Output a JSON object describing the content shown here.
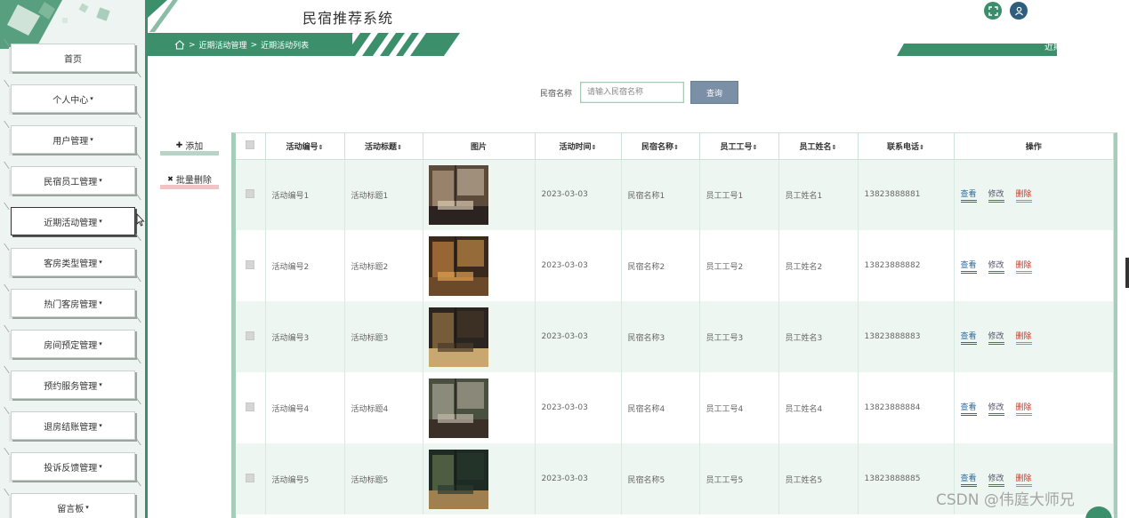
{
  "app": {
    "title": "民宿推荐系统"
  },
  "sidebar": {
    "items": [
      {
        "label": "首页",
        "caret": ""
      },
      {
        "label": "个人中心",
        "caret": "▾"
      },
      {
        "label": "用户管理",
        "caret": "▾"
      },
      {
        "label": "民宿员工管理",
        "caret": "▾"
      },
      {
        "label": "近期活动管理",
        "caret": "▾"
      },
      {
        "label": "客房类型管理",
        "caret": "▾"
      },
      {
        "label": "热门客房管理",
        "caret": "▾"
      },
      {
        "label": "房间预定管理",
        "caret": "▾"
      },
      {
        "label": "预约服务管理",
        "caret": "▾"
      },
      {
        "label": "退房结账管理",
        "caret": "▾"
      },
      {
        "label": "投诉反馈管理",
        "caret": "▾"
      },
      {
        "label": "留言板",
        "caret": "▾"
      }
    ]
  },
  "breadcrumb": {
    "sep1": ">",
    "level1": "近期活动管理",
    "sep2": ">",
    "level2": "近期活动列表"
  },
  "section_title": "近期活动管理",
  "search": {
    "label": "民宿名称",
    "placeholder": "请输入民宿名称",
    "button": "查询"
  },
  "actions": {
    "add": "添加",
    "add_icon": "✚",
    "batch_delete": "批量删除",
    "batch_delete_icon": "✖"
  },
  "table": {
    "headers": {
      "activity_no": "活动编号",
      "activity_title": "活动标题",
      "image": "图片",
      "activity_time": "活动时间",
      "homestay_name": "民宿名称",
      "staff_no": "员工工号",
      "staff_name": "员工姓名",
      "phone": "联系电话",
      "ops": "操作",
      "sort_icon": "⇕"
    },
    "op_labels": {
      "view": "查看",
      "edit": "修改",
      "delete": "删除"
    },
    "rows": [
      {
        "activity_no": "活动编号1",
        "activity_title": "活动标题1",
        "activity_time": "2023-03-03",
        "homestay_name": "民宿名称1",
        "staff_no": "员工工号1",
        "staff_name": "员工姓名1",
        "phone": "13823888881"
      },
      {
        "activity_no": "活动编号2",
        "activity_title": "活动标题2",
        "activity_time": "2023-03-03",
        "homestay_name": "民宿名称2",
        "staff_no": "员工工号2",
        "staff_name": "员工姓名2",
        "phone": "13823888882"
      },
      {
        "activity_no": "活动编号3",
        "activity_title": "活动标题3",
        "activity_time": "2023-03-03",
        "homestay_name": "民宿名称3",
        "staff_no": "员工工号3",
        "staff_name": "员工姓名3",
        "phone": "13823888883"
      },
      {
        "activity_no": "活动编号4",
        "activity_title": "活动标题4",
        "activity_time": "2023-03-03",
        "homestay_name": "民宿名称4",
        "staff_no": "员工工号4",
        "staff_name": "员工姓名4",
        "phone": "13823888884"
      },
      {
        "activity_no": "活动编号5",
        "activity_title": "活动标题5",
        "activity_time": "2023-03-03",
        "homestay_name": "民宿名称5",
        "staff_no": "员工工号5",
        "staff_name": "员工姓名5",
        "phone": "13823888885"
      }
    ]
  },
  "watermark": "CSDN @伟庭大师兄",
  "colors": {
    "primary_green": "#3c8f6b",
    "row_alt": "#eef6f1",
    "link_blue": "#2b6ca3",
    "delete_red": "#c0392b"
  },
  "icons": [
    "home-icon",
    "fullscreen-icon",
    "user-icon",
    "plus-icon",
    "close-icon",
    "sort-icon"
  ]
}
